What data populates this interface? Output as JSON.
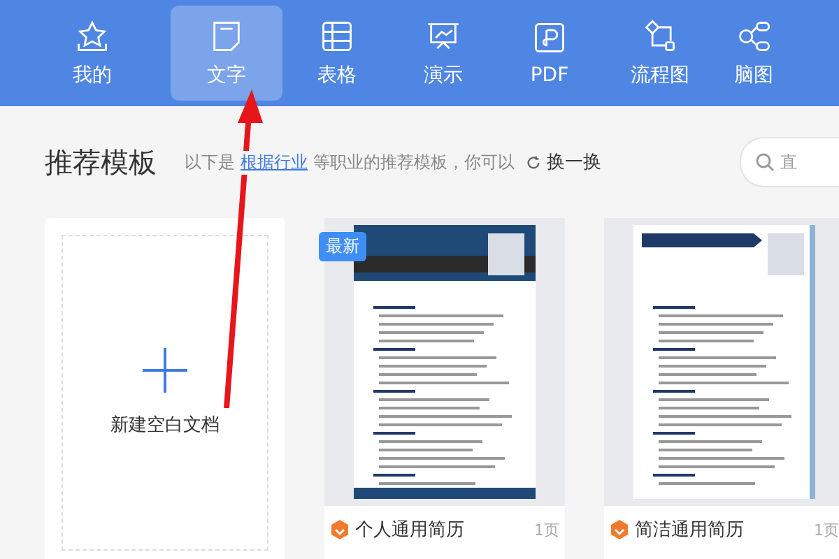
{
  "nav": {
    "tabs": [
      {
        "label": "我的",
        "selected": false
      },
      {
        "label": "文字",
        "selected": true
      },
      {
        "label": "表格",
        "selected": false
      },
      {
        "label": "演示",
        "selected": false
      },
      {
        "label": "PDF",
        "selected": false
      },
      {
        "label": "流程图",
        "selected": false
      },
      {
        "label": "脑图",
        "selected": false
      }
    ]
  },
  "section": {
    "title": "推荐模板",
    "intro": "以下是",
    "link": "根据行业",
    "suffix": "等职业的推荐模板，你可以",
    "refresh": "换一换",
    "search": {
      "placeholder": "直"
    }
  },
  "cards": [
    {
      "kind": "blank",
      "label": "新建空白文档"
    },
    {
      "kind": "template",
      "badge": "最新",
      "title": "个人通用简历",
      "pages": "1页"
    },
    {
      "kind": "template",
      "title": "简洁通用简历",
      "pages": "1页"
    }
  ]
}
